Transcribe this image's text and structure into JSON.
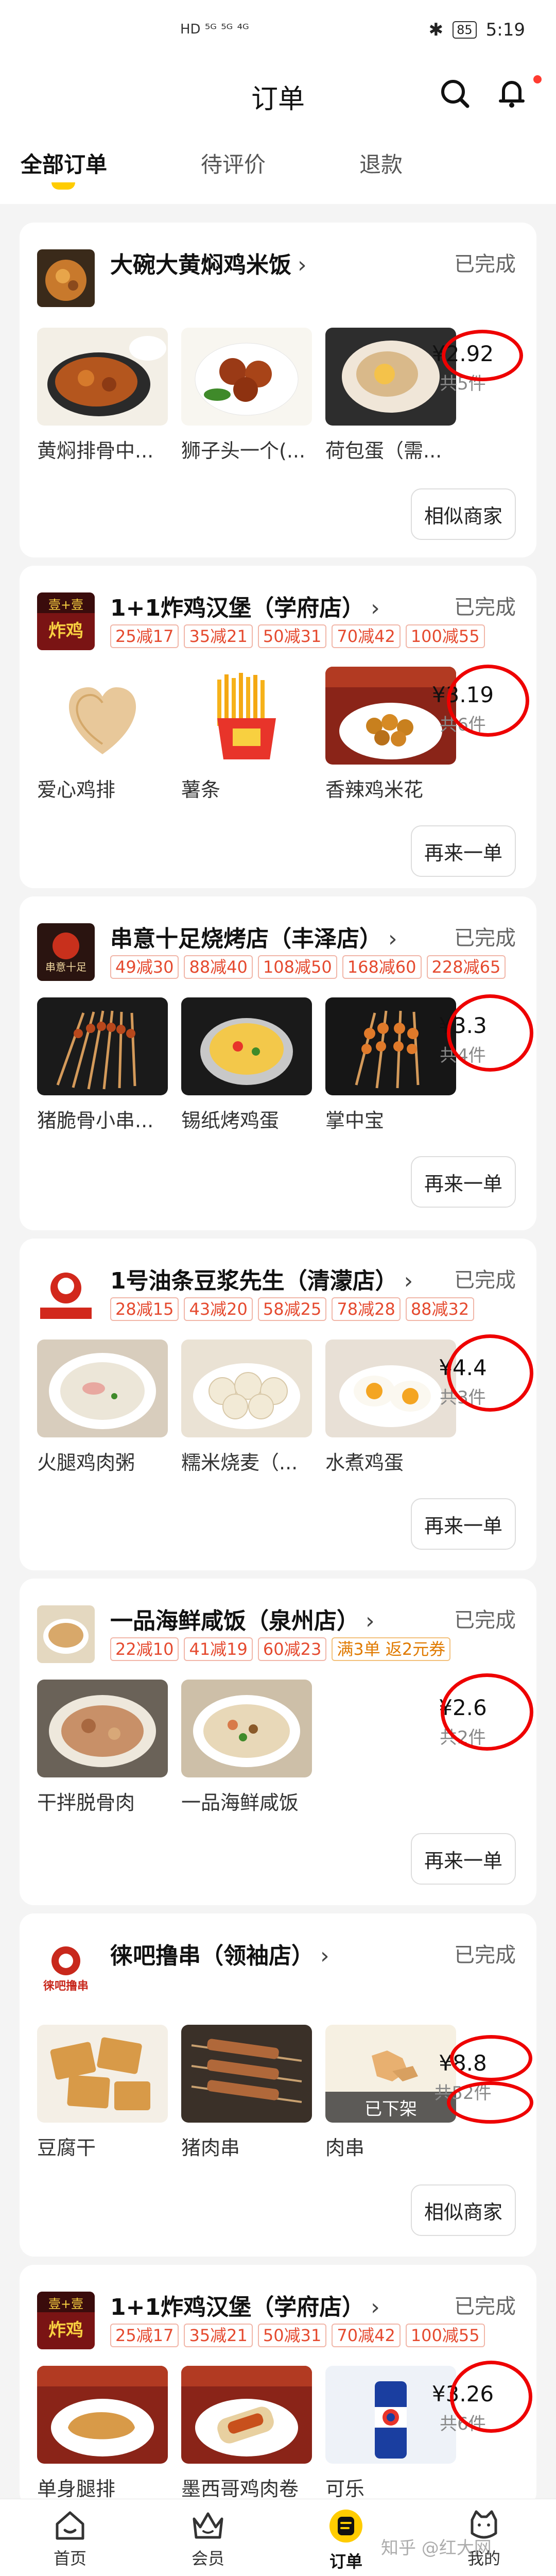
{
  "status_bar": {
    "left": "HD ⁵ᴳ ⁵ᴳ ⁴ᴳ",
    "battery": "85",
    "time": "5:19"
  },
  "header": {
    "title": "订单",
    "search_icon": "search-icon",
    "bell_icon": "bell-icon"
  },
  "tabs": [
    {
      "label": "全部订单"
    },
    {
      "label": "待评价"
    },
    {
      "label": "退款"
    }
  ],
  "orders": [
    {
      "store": "大碗大黄焖鸡米饭",
      "status": "已完成",
      "promos": [],
      "items": [
        "黄焖排骨中...",
        "狮子头一个(...",
        "荷包蛋（需..."
      ],
      "price": "¥2.92",
      "count": "共5件",
      "button": "相似商家"
    },
    {
      "store": "1+1炸鸡汉堡（学府店）",
      "status": "已完成",
      "promos": [
        "25减17",
        "35减21",
        "50减31",
        "70减42",
        "100减55"
      ],
      "items": [
        "爱心鸡排",
        "薯条",
        "香辣鸡米花"
      ],
      "price": "¥3.19",
      "count": "共6件",
      "button": "再来一单"
    },
    {
      "store": "串意十足烧烤店（丰泽店）",
      "status": "已完成",
      "promos": [
        "49减30",
        "88减40",
        "108减50",
        "168减60",
        "228减65"
      ],
      "items": [
        "猪脆骨小串...",
        "锡纸烤鸡蛋",
        "掌中宝"
      ],
      "price": "¥3.3",
      "count": "共4件",
      "button": "再来一单"
    },
    {
      "store": "1号油条豆浆先生（清濛店）",
      "status": "已完成",
      "promos": [
        "28减15",
        "43减20",
        "58减25",
        "78减28",
        "88减32"
      ],
      "items": [
        "火腿鸡肉粥",
        "糯米烧麦（...",
        "水煮鸡蛋"
      ],
      "price": "¥4.4",
      "count": "共3件",
      "button": "再来一单"
    },
    {
      "store": "一品海鲜咸饭（泉州店）",
      "status": "已完成",
      "promos": [
        "22减10",
        "41减19",
        "60减23",
        "满3单 返2元券"
      ],
      "items": [
        "干拌脱骨肉",
        "一品海鲜咸饭"
      ],
      "price": "¥2.6",
      "count": "共2件",
      "button": "再来一单"
    },
    {
      "store": "徕吧撸串（领袖店）",
      "status": "已完成",
      "promos": [],
      "items": [
        "豆腐干",
        "猪肉串",
        "肉串"
      ],
      "offshelf": "已下架",
      "price": "¥8.8",
      "count": "共52件",
      "button": "相似商家"
    },
    {
      "store": "1+1炸鸡汉堡（学府店）",
      "status": "已完成",
      "promos": [
        "25减17",
        "35减21",
        "50减31",
        "70减42",
        "100减55"
      ],
      "items": [
        "单身腿排",
        "墨西哥鸡肉卷",
        "可乐"
      ],
      "price": "¥3.26",
      "count": "共6件",
      "button": ""
    }
  ],
  "bottom_nav": [
    {
      "label": "首页",
      "icon": "home-icon"
    },
    {
      "label": "会员",
      "icon": "crown-icon"
    },
    {
      "label": "订单",
      "icon": "order-icon"
    },
    {
      "label": "我的",
      "icon": "profile-icon"
    }
  ],
  "watermark": "知乎 @红大网",
  "colors": {
    "accent": "#ffcc00",
    "promo_red": "#e54a2f",
    "highlight_circle": "#e00000"
  }
}
